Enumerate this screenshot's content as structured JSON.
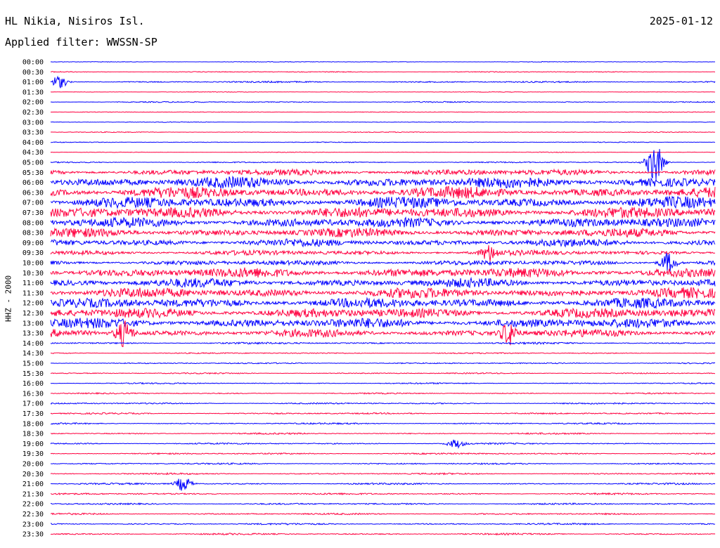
{
  "header": {
    "station": "HL Nikia, Nisiros Isl.",
    "date": "2025-01-12",
    "filter": "Applied filter: WWSSN-SP"
  },
  "chart_data": {
    "type": "line",
    "title": "HL Nikia, Nisiros Isl.",
    "subtitle": "Applied filter: WWSSN-SP",
    "ylabel": "HHZ - 2000",
    "xlabel": "",
    "row_labels": [
      "00:00",
      "00:30",
      "01:00",
      "01:30",
      "02:00",
      "02:30",
      "03:00",
      "03:30",
      "04:00",
      "04:30",
      "05:00",
      "05:30",
      "06:00",
      "06:30",
      "07:00",
      "07:30",
      "08:00",
      "08:30",
      "09:00",
      "09:30",
      "10:00",
      "10:30",
      "11:00",
      "11:30",
      "12:00",
      "12:30",
      "13:00",
      "13:30",
      "14:00",
      "14:30",
      "15:00",
      "15:30",
      "16:00",
      "16:30",
      "17:00",
      "17:30",
      "18:00",
      "18:30",
      "19:00",
      "19:30",
      "20:00",
      "20:30",
      "21:00",
      "21:30",
      "22:00",
      "22:30",
      "23:00",
      "23:30"
    ],
    "colors": {
      "even_rows": "#0000ff",
      "odd_rows": "#ff0040"
    },
    "activity_level": [
      0.5,
      0.7,
      1.2,
      0.4,
      0.9,
      0.5,
      0.5,
      0.6,
      0.6,
      0.5,
      1.0,
      5.0,
      9.0,
      9.0,
      9.0,
      9.0,
      8.0,
      7.0,
      6.0,
      4.0,
      4.0,
      8.0,
      7.0,
      8.0,
      8.0,
      8.0,
      8.0,
      6.0,
      1.5,
      1.0,
      1.0,
      1.0,
      1.0,
      1.0,
      1.2,
      1.2,
      1.2,
      1.2,
      1.2,
      1.2,
      1.2,
      1.2,
      1.3,
      1.3,
      1.3,
      1.3,
      1.3,
      1.3
    ],
    "events": [
      {
        "row": "01:00",
        "position": 0.012,
        "amplitude": 9
      },
      {
        "row": "05:00",
        "position": 0.91,
        "amplitude": 28
      },
      {
        "row": "09:30",
        "position": 0.66,
        "amplitude": 10
      },
      {
        "row": "10:00",
        "position": 0.93,
        "amplitude": 14
      },
      {
        "row": "13:30",
        "position": 0.11,
        "amplitude": 18
      },
      {
        "row": "13:30",
        "position": 0.69,
        "amplitude": 16
      },
      {
        "row": "19:00",
        "position": 0.61,
        "amplitude": 6
      },
      {
        "row": "21:00",
        "position": 0.2,
        "amplitude": 10
      }
    ]
  }
}
